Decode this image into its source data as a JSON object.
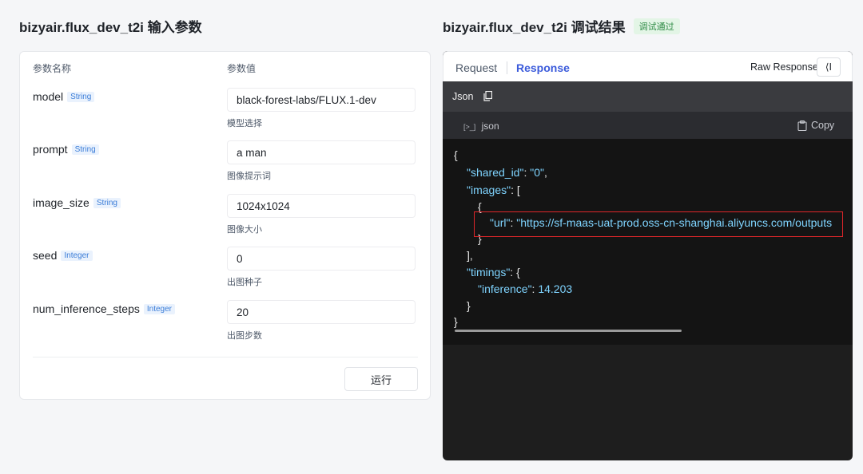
{
  "left_panel": {
    "title": "bizyair.flux_dev_t2i 输入参数",
    "col_name": "参数名称",
    "col_value": "参数值",
    "params": [
      {
        "name": "model",
        "type": "String",
        "value": "black-forest-labs/FLUX.1-dev",
        "hint": "模型选择"
      },
      {
        "name": "prompt",
        "type": "String",
        "value": "a man",
        "hint": "图像提示词"
      },
      {
        "name": "image_size",
        "type": "String",
        "value": "1024x1024",
        "hint": "图像大小"
      },
      {
        "name": "seed",
        "type": "Integer",
        "value": "0",
        "hint": "出图种子"
      },
      {
        "name": "num_inference_steps",
        "type": "Integer",
        "value": "20",
        "hint": "出图步数"
      }
    ],
    "run_label": "运行"
  },
  "right_panel": {
    "title": "bizyair.flux_dev_t2i 调试结果",
    "status_badge": "调试通过",
    "tabs": {
      "request": "Request",
      "response": "Response"
    },
    "active_tab": "Response",
    "raw_response_label": "Raw Response",
    "collapse_label": "⟨I",
    "json_label": "Json",
    "code_lang_prefix": "[>_]",
    "code_lang": "json",
    "copy_label": "Copy",
    "code": {
      "open_brace": "{",
      "shared_id_key": "\"shared_id\"",
      "shared_id_value": "\"0\"",
      "images_key": "\"images\"",
      "open_bracket": "[",
      "item_open": "{",
      "url_key": "\"url\"",
      "url_value": "\"https://sf-maas-uat-prod.oss-cn-shanghai.aliyuncs.com/outputs",
      "item_close": "}",
      "close_bracket": "],",
      "timings_key": "\"timings\"",
      "inference_key": "\"inference\"",
      "inference_value": "14.203",
      "timings_close": "}",
      "close_brace": "}"
    }
  },
  "colors": {
    "accent": "#3b5bdb",
    "status_bg": "#e3f5e6",
    "status_text": "#2e8b45",
    "code_bg": "#141414",
    "json_key": "#7fd4ff",
    "highlight_border": "#e0262a"
  }
}
